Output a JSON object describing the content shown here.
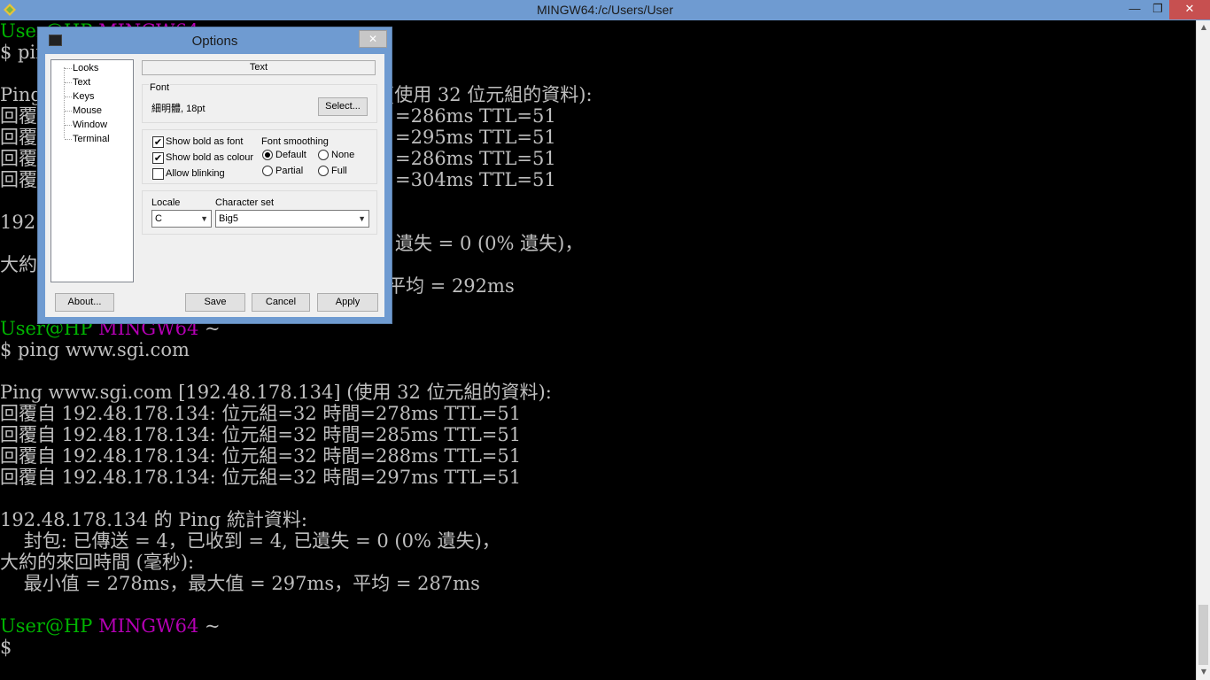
{
  "window": {
    "title": "MINGW64:/c/Users/User",
    "minimize": "—",
    "maximize": "❐",
    "close": "✕"
  },
  "terminal": {
    "lines": [
      {
        "user": "User@HP",
        "host": "MINGW64",
        "path": "~"
      },
      {
        "text": "$ ping"
      },
      {
        "text": ""
      },
      {
        "text": "Ping",
        "tail": "(使用 32 位元組的資料):"
      },
      {
        "text": "回覆",
        "tail": "=286ms TTL=51"
      },
      {
        "text": "回覆",
        "tail": "=295ms TTL=51"
      },
      {
        "text": "回覆",
        "tail": "=286ms TTL=51"
      },
      {
        "text": "回覆",
        "tail": "=304ms TTL=51"
      },
      {
        "text": ""
      },
      {
        "text": "192.",
        "tail": "遺失 = 0 (0% 遺失)，"
      },
      {
        "text": "大約",
        "tail": ""
      },
      {
        "text": "",
        "tail": "平均 = 292ms"
      },
      {
        "text": ""
      },
      {
        "user": "User@HP",
        "host": "MINGW64",
        "path": "~"
      },
      {
        "text": "$ ping www.sgi.com"
      },
      {
        "text": ""
      },
      {
        "text": "Ping www.sgi.com [192.48.178.134] (使用 32 位元組的資料):"
      },
      {
        "text": "回覆自 192.48.178.134: 位元組=32 時間=278ms TTL=51"
      },
      {
        "text": "回覆自 192.48.178.134: 位元組=32 時間=285ms TTL=51"
      },
      {
        "text": "回覆自 192.48.178.134: 位元組=32 時間=288ms TTL=51"
      },
      {
        "text": "回覆自 192.48.178.134: 位元組=32 時間=297ms TTL=51"
      },
      {
        "text": ""
      },
      {
        "text": "192.48.178.134 的 Ping 統計資料:"
      },
      {
        "text": "    封包: 已傳送 = 4，已收到 = 4, 已遺失 = 0 (0% 遺失)，"
      },
      {
        "text": "大約的來回時間 (毫秒):"
      },
      {
        "text": "    最小值 = 278ms，最大值 = 297ms，平均 = 287ms"
      },
      {
        "text": ""
      },
      {
        "user": "User@HP",
        "host": "MINGW64",
        "path": "~"
      },
      {
        "text": "$"
      }
    ]
  },
  "dialog": {
    "title": "Options",
    "close": "✕",
    "nav": [
      "Looks",
      "Text",
      "Keys",
      "Mouse",
      "Window",
      "Terminal"
    ],
    "active_tab": "Text",
    "font": {
      "group_label": "Font",
      "value": "細明體, 18pt",
      "select_button": "Select..."
    },
    "checkboxes": [
      {
        "label": "Show bold as font",
        "checked": "✔"
      },
      {
        "label": "Show bold as colour",
        "checked": "✔"
      },
      {
        "label": "Allow blinking",
        "checked": ""
      }
    ],
    "smoothing": {
      "label": "Font smoothing",
      "options": [
        "Default",
        "None",
        "Partial",
        "Full"
      ],
      "selected": "Default"
    },
    "locale": {
      "label": "Locale",
      "value": "C"
    },
    "charset": {
      "label": "Character set",
      "value": "Big5"
    },
    "buttons": {
      "about": "About...",
      "save": "Save",
      "cancel": "Cancel",
      "apply": "Apply"
    }
  },
  "colors": {
    "title_bar": "#6f9bd1",
    "prompt_user": "#00b300",
    "prompt_host": "#b400b4",
    "terminal_bg": "#000000",
    "terminal_fg": "#bfbfbf"
  }
}
